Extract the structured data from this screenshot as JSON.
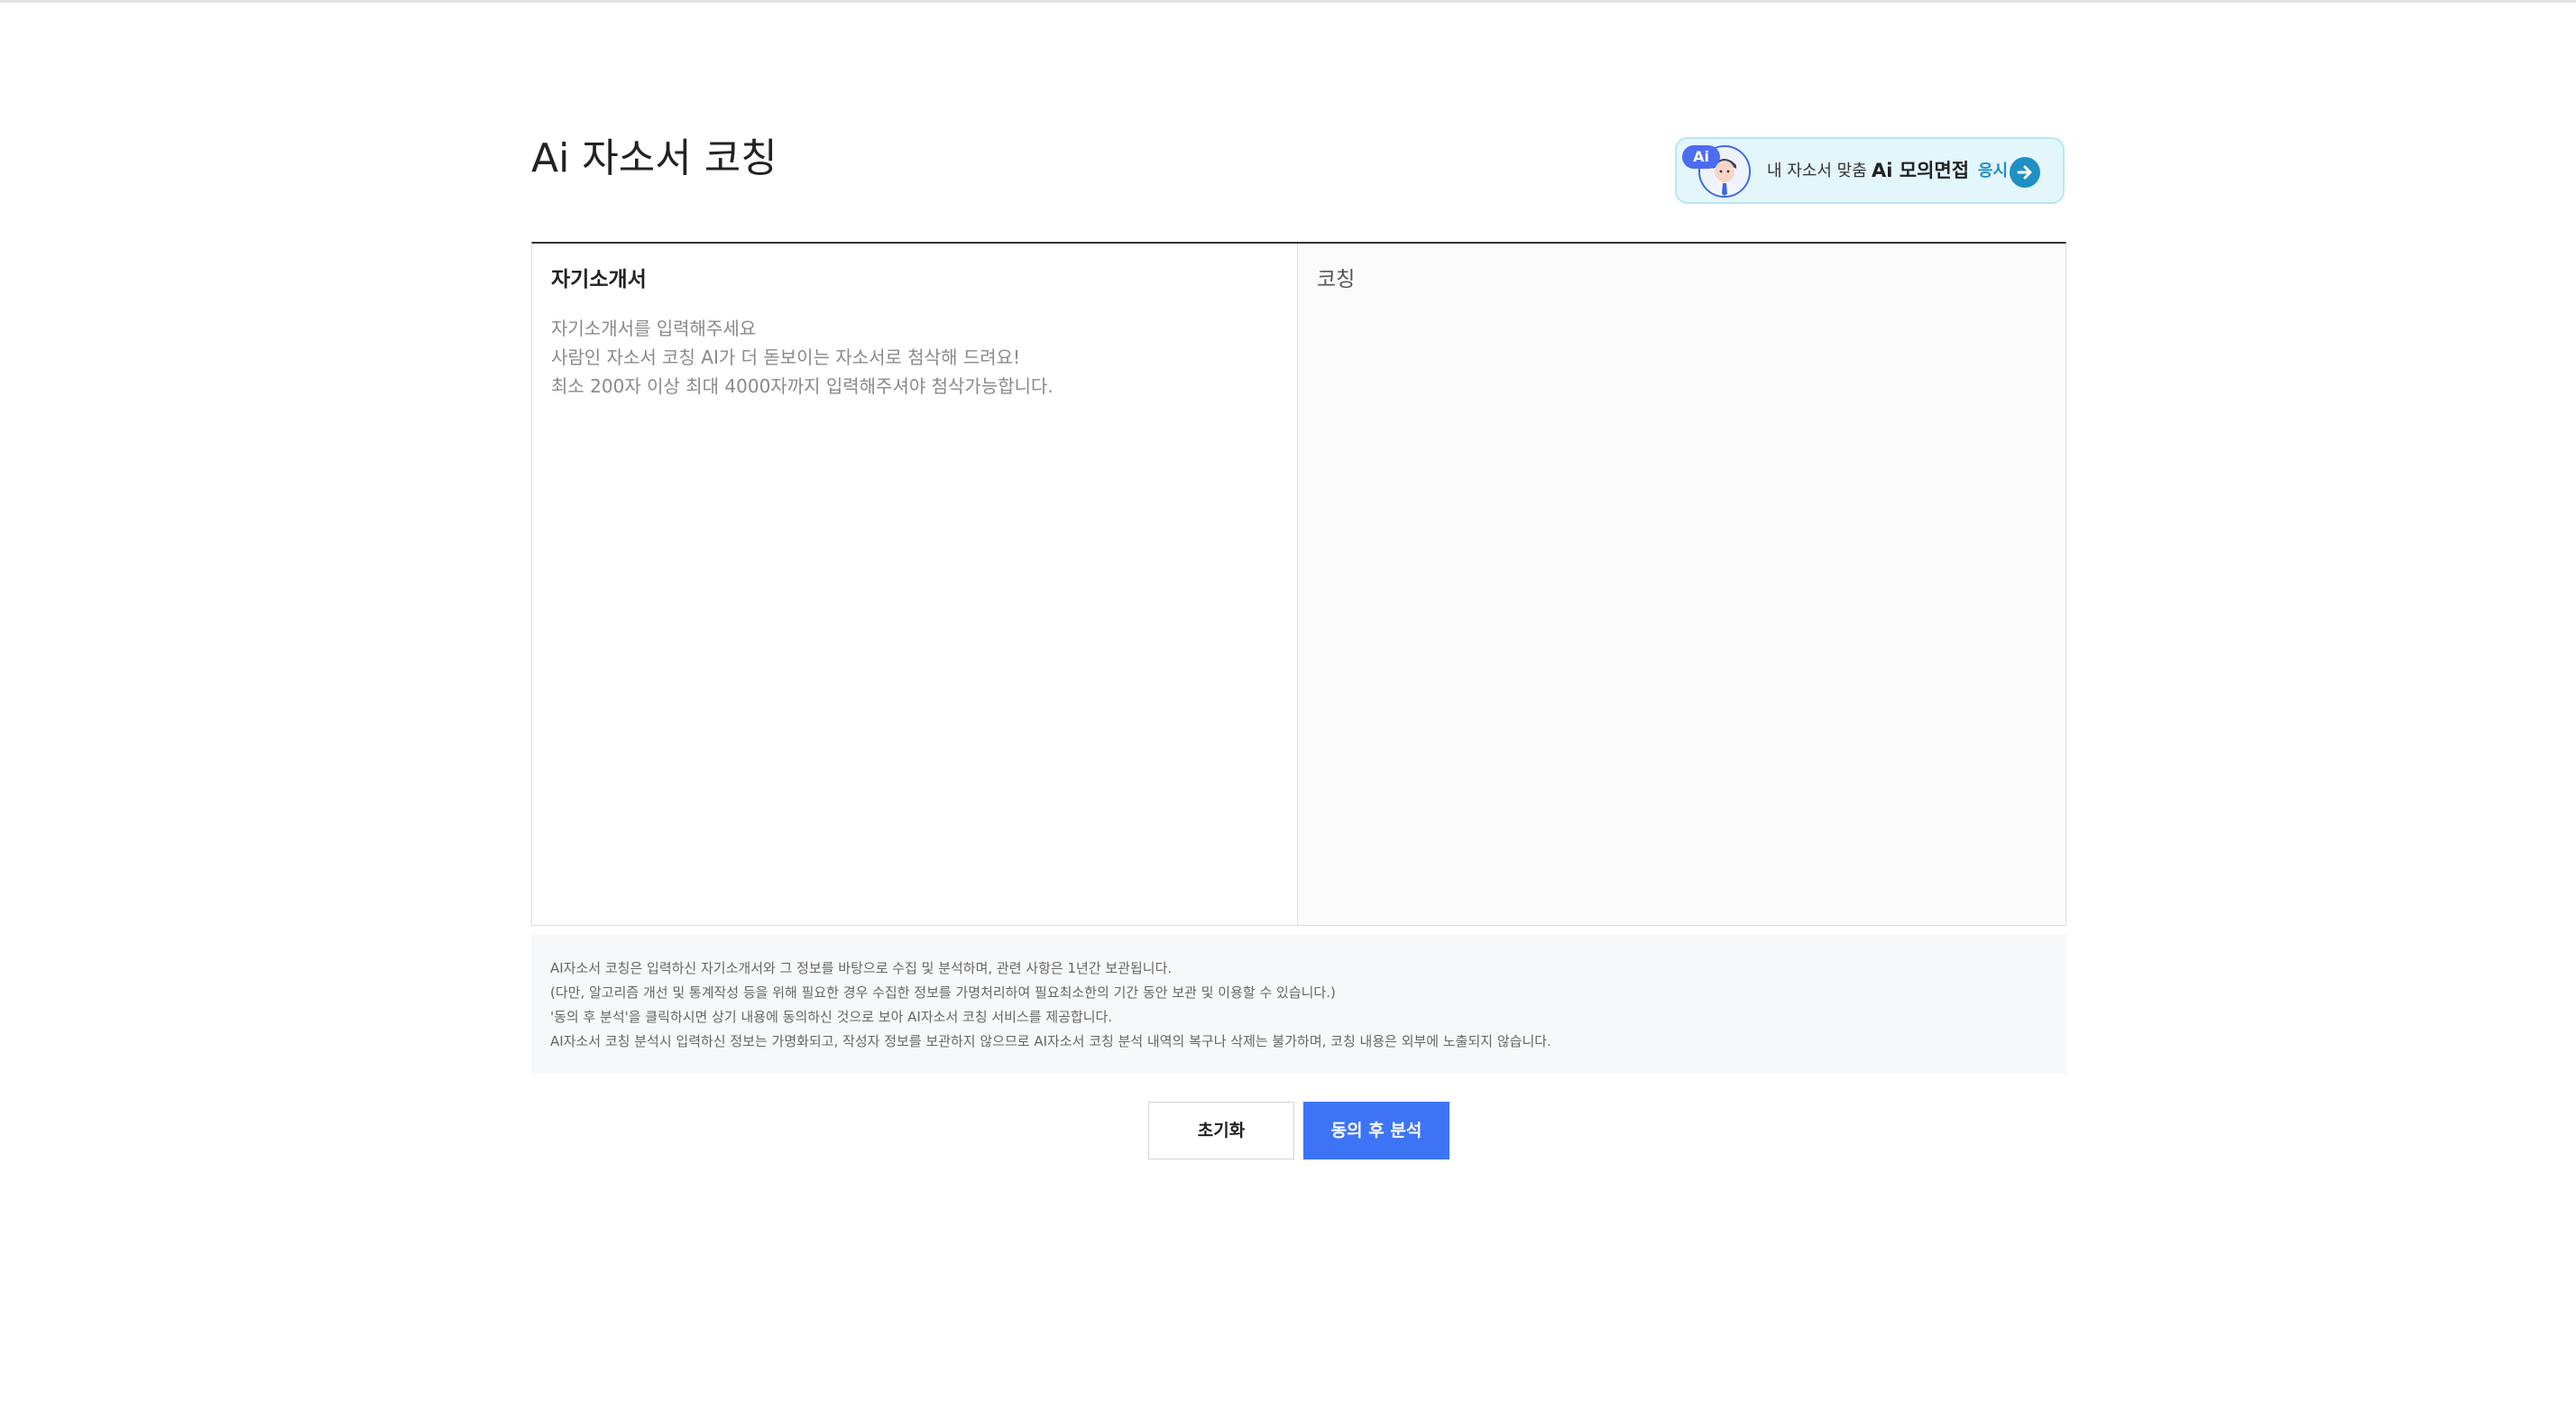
{
  "page": {
    "title": "Ai 자소서 코칭"
  },
  "banner": {
    "badge": "Ai",
    "text": "내 자소서 맞춤",
    "strong": "Ai 모의면접",
    "apply": "응시",
    "accent_color": "#1f8fc4"
  },
  "editor": {
    "heading": "자기소개서",
    "value": "",
    "placeholder": "자기소개서를 입력해주세요\n사람인 자소서 코칭 AI가 더 돋보이는 자소서로 첨삭해 드려요!\n최소 200자 이상 최대 4000자까지 입력해주셔야 첨삭가능합니다."
  },
  "coaching": {
    "heading": "코칭"
  },
  "notice": {
    "lines": [
      "AI자소서 코칭은 입력하신 자기소개서와 그 정보를 바탕으로 수집 및 분석하며, 관련 사항은 1년간 보관됩니다.",
      "(다만, 알고리즘 개선 및 통계작성 등을 위해 필요한 경우 수집한 정보를 가명처리하여 필요최소한의 기간 동안 보관 및 이용할 수 있습니다.)",
      "'동의 후 분석'을 클릭하시면 상기 내용에 동의하신 것으로 보아 AI자소서 코칭 서비스를 제공합니다.",
      "AI자소서 코칭 분석시 입력하신 정보는 가명화되고, 작성자 정보를 보관하지 않으므로 AI자소서 코칭 분석 내역의 복구나 삭제는 불가하며, 코칭 내용은 외부에 노출되지 않습니다."
    ]
  },
  "buttons": {
    "reset": "초기화",
    "analyze": "동의 후 분석",
    "primary_color": "#3d74f6"
  }
}
